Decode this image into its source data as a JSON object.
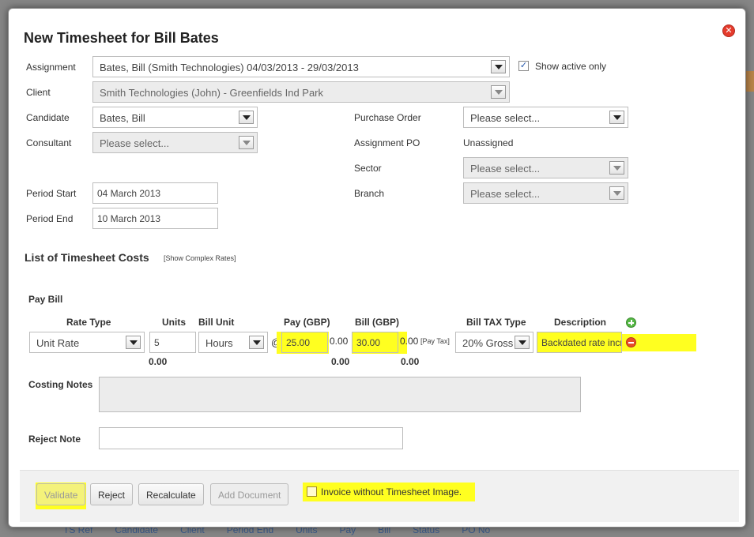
{
  "modal": {
    "title": "New Timesheet for Bill Bates",
    "close_icon": "close-icon"
  },
  "form": {
    "assignment_label": "Assignment",
    "assignment_value": "Bates, Bill (Smith Technologies) 04/03/2013 - 29/03/2013",
    "show_active_label": "Show active only",
    "show_active_checked": true,
    "client_label": "Client",
    "client_value": "Smith Technologies (John) - Greenfields Ind Park",
    "candidate_label": "Candidate",
    "candidate_value": "Bates, Bill",
    "consultant_label": "Consultant",
    "consultant_value": "Please select...",
    "purchase_order_label": "Purchase Order",
    "purchase_order_value": "Please select...",
    "assignment_po_label": "Assignment PO",
    "assignment_po_value": "Unassigned",
    "sector_label": "Sector",
    "sector_value": "Please select...",
    "branch_label": "Branch",
    "branch_value": "Please select...",
    "period_start_label": "Period Start",
    "period_start_value": "04 March 2013",
    "period_end_label": "Period End",
    "period_end_value": "10 March 2013"
  },
  "costs": {
    "section_title": "List of Timesheet Costs",
    "complex_rates_link": "[Show Complex Rates]",
    "pay_bill_label": "Pay Bill",
    "headers": {
      "rate_type": "Rate Type",
      "units": "Units",
      "bill_unit": "Bill Unit",
      "pay": "Pay (GBP)",
      "bill": "Bill (GBP)",
      "bill_tax_type": "Bill TAX Type",
      "description": "Description"
    },
    "row": {
      "rate_type": "Unit Rate",
      "units": "5",
      "bill_unit": "Hours",
      "at": "@",
      "pay": "25.00",
      "pay_extra": "0.00",
      "bill": "30.00",
      "bill_extra": "0.00",
      "pay_tax": "[Pay Tax]",
      "bill_tax_type": "20% Gross",
      "description": "Backdated rate increase"
    },
    "totals": {
      "units": "0.00",
      "pay": "0.00",
      "bill": "0.00"
    },
    "costing_notes_label": "Costing Notes",
    "reject_note_label": "Reject Note"
  },
  "footer": {
    "validate": "Validate",
    "reject": "Reject",
    "recalculate": "Recalculate",
    "add_document": "Add Document",
    "invoice_without_image": "Invoice without Timesheet Image."
  },
  "background": {
    "header_cols": [
      "TS Ref",
      "Candidate",
      "Client",
      "Period End",
      "Units",
      "Pay",
      "Bill",
      "Status",
      "PO No"
    ]
  },
  "colors": {
    "highlight": "#ffff20",
    "close": "#e53b2c",
    "add": "#55b845",
    "remove": "#e84c2a"
  }
}
